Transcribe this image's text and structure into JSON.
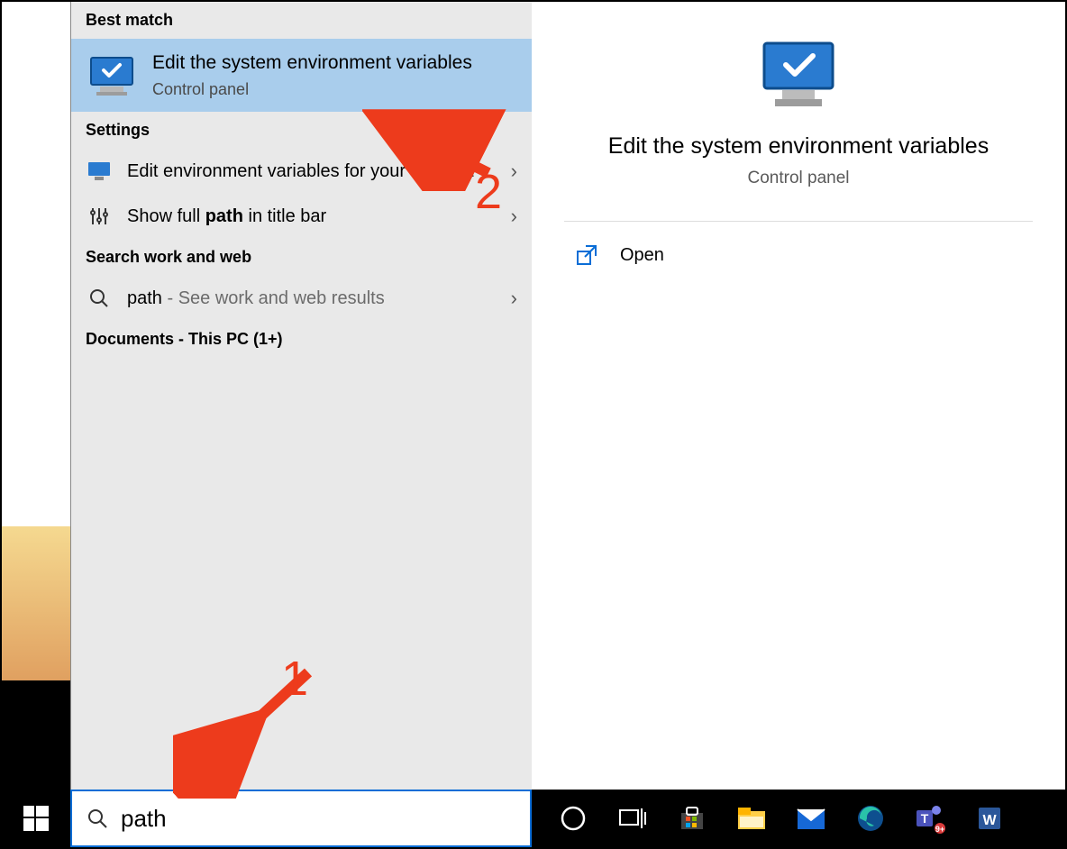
{
  "sections": {
    "best_match_header": "Best match",
    "settings_header": "Settings",
    "search_web_header": "Search work and web",
    "documents_header": "Documents - This PC (1+)"
  },
  "best_match": {
    "title": "Edit the system environment variables",
    "subtitle": "Control panel"
  },
  "settings_items": [
    {
      "label_plain": "Edit environment variables for your account",
      "bold_word": ""
    },
    {
      "label_pre": "Show full ",
      "label_bold": "path",
      "label_post": " in title bar"
    }
  ],
  "web_search": {
    "term": "path",
    "suffix": " - See work and web results"
  },
  "preview": {
    "title": "Edit the system environment variables",
    "subtitle": "Control panel",
    "open_label": "Open"
  },
  "search_input": {
    "value": "path"
  },
  "annotations": {
    "one": "1",
    "two": "2"
  }
}
